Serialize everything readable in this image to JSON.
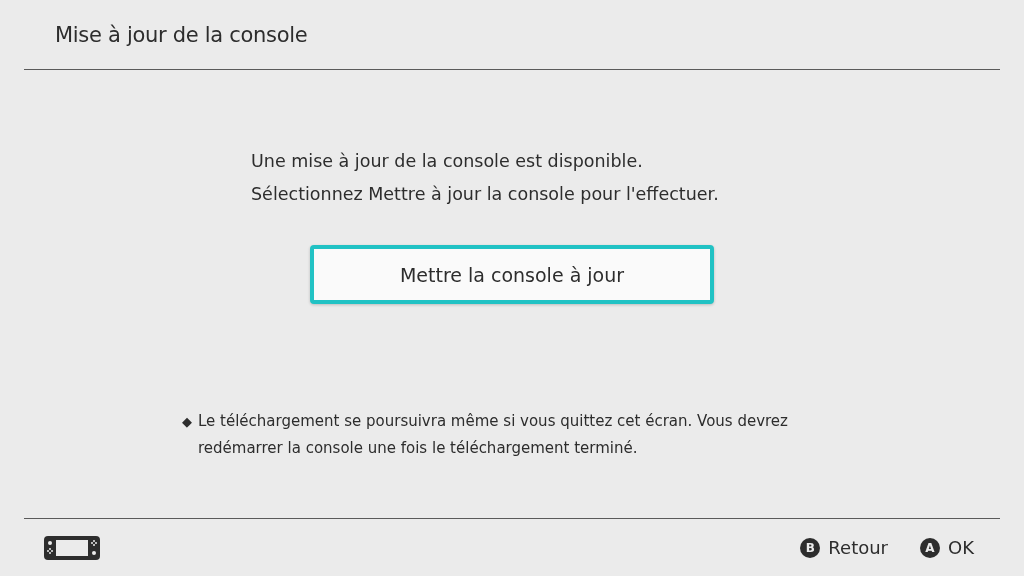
{
  "header": {
    "title": "Mise à jour de la console"
  },
  "message": [
    "Une mise à jour de la console est disponible.",
    "Sélectionnez Mettre à jour la console pour l'effectuer."
  ],
  "button": {
    "label": "Mettre la console à jour",
    "selected": true
  },
  "note": {
    "bullet": "◆",
    "text": "Le téléchargement se poursuivra même si vous quittez cet écran. Vous devrez redémarrer la console une fois le téléchargement terminé."
  },
  "footer": {
    "hints": [
      {
        "key": "B",
        "label": "Retour"
      },
      {
        "key": "A",
        "label": "OK"
      }
    ]
  }
}
